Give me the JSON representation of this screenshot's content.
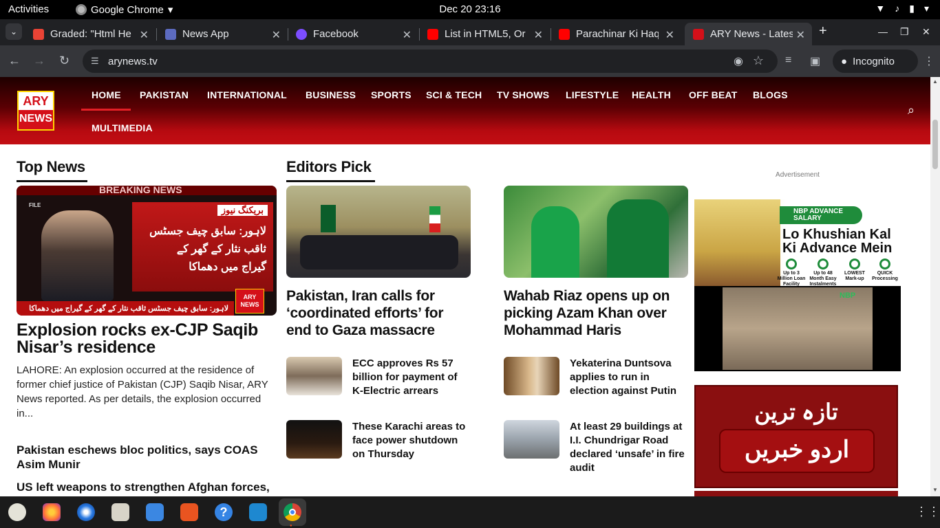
{
  "topbar": {
    "activities": "Activities",
    "app_name": "Google Chrome",
    "datetime": "Dec 20  23:16"
  },
  "tabs": [
    {
      "title": "Graded: \"Html He",
      "favicon_color": "#ea4335"
    },
    {
      "title": "News App",
      "favicon_color": "#5c6bc0"
    },
    {
      "title": "Facebook",
      "favicon_color": "#7c4dff"
    },
    {
      "title": "List in HTML5, Or",
      "favicon_color": "#ff0000"
    },
    {
      "title": "Parachinar Ki Haq",
      "favicon_color": "#ff0000"
    },
    {
      "title": "ARY News - Latest",
      "favicon_color": "#d41019",
      "active": true
    }
  ],
  "toolbar": {
    "url": "arynews.tv",
    "incognito_label": "Incognito"
  },
  "site": {
    "logo_top": "ARY",
    "logo_bottom": "NEWS",
    "nav": [
      "HOME",
      "PAKISTAN",
      "INTERNATIONAL",
      "BUSINESS",
      "SPORTS",
      "SCI & TECH",
      "TV SHOWS",
      "LIFESTYLE",
      "HEALTH",
      "OFF BEAT",
      "BLOGS",
      "MULTIMEDIA"
    ]
  },
  "top_news": {
    "section_title": "Top News",
    "image_banner": "BREAKING NEWS",
    "image_urdu_tag": "بریکنگ نیوز",
    "image_urdu_text": "لاہور: سابق چیف جسٹس ثاقب نثار کے گھر کے گیراج میں دھماکا",
    "image_urdu_ticker": "لاہور: سابق چیف جسٹس ثاقب نثار کے گھر کے گیراج میں دھماکا",
    "image_file_tag": "FILE",
    "headline": "Explosion rocks ex-CJP Saqib Nisar’s residence",
    "summary": "LAHORE: An explosion occurred at the residence of former chief justice of Pakistan (CJP) Saqib Nisar, ARY News reported. As per details, the explosion occurred in...",
    "more": [
      "Pakistan eschews bloc politics, says COAS Asim Munir",
      "US left weapons to strengthen Afghan forces,"
    ]
  },
  "editors_pick": {
    "section_title": "Editors Pick",
    "features": [
      {
        "headline": "Pakistan, Iran calls for ‘coordinated efforts’ for end to Gaza massacre"
      },
      {
        "headline": "Wahab Riaz opens up on picking Azam Khan over Mohammad Haris"
      }
    ],
    "small": [
      {
        "headline": "ECC approves Rs 57 billion for payment of K-Electric arrears"
      },
      {
        "headline": "Yekaterina Duntsova applies to run in election against Putin"
      },
      {
        "headline": "These Karachi areas to face power shutdown on Thursday"
      },
      {
        "headline": "At least 29 buildings at I.I. Chundrigar Road declared ‘unsafe’ in fire audit"
      }
    ]
  },
  "ads": {
    "label": "Advertisement",
    "nbp_badge": "NBP ADVANCE SALARY",
    "nbp_line1": "Lo Khushian Kal",
    "nbp_line2": "Ki Advance Mein",
    "nbp_features": [
      "Up to 3 Million Loan Facility",
      "Up to 48 Month Easy Instalments",
      "LOWEST Mark-up",
      "QUICK Processing"
    ],
    "nbp_video_logo": "NBP",
    "urdu_line1": "تازہ ترین",
    "urdu_line2": "اردو خبریں"
  },
  "colors": {
    "brand_red": "#d41019",
    "nav_active": "#e41f26"
  }
}
